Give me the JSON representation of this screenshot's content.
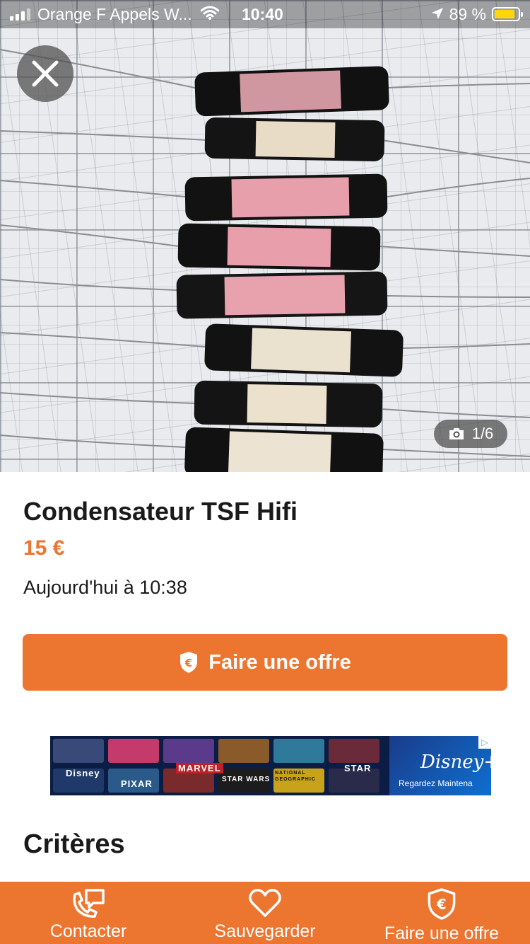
{
  "status_bar": {
    "carrier": "Orange F Appels W...",
    "time": "10:40",
    "battery": "89 %"
  },
  "gallery": {
    "counter": "1/6"
  },
  "listing": {
    "title": "Condensateur TSF Hifi",
    "price": "15 €",
    "date": "Aujourd'hui à 10:38"
  },
  "offer_button": {
    "label": "Faire une offre"
  },
  "ad": {
    "tiles": [
      "Disney",
      "PIXAR",
      "MARVEL",
      "STAR WARS",
      "NATIONAL GEOGRAPHIC",
      "STAR"
    ],
    "brand": "Disney+",
    "tagline": "Regardez Maintena"
  },
  "section": {
    "criteria_title": "Critères"
  },
  "bottom_nav": {
    "contact": "Contacter",
    "save": "Sauvegarder",
    "offer": "Faire une offre"
  },
  "colors": {
    "accent": "#ec7530",
    "battery": "#ffd60a"
  },
  "icons": {
    "close": "close-icon",
    "camera": "camera-icon",
    "shield_euro": "shield-euro-icon",
    "phone_chat": "phone-chat-icon",
    "heart": "heart-icon"
  }
}
